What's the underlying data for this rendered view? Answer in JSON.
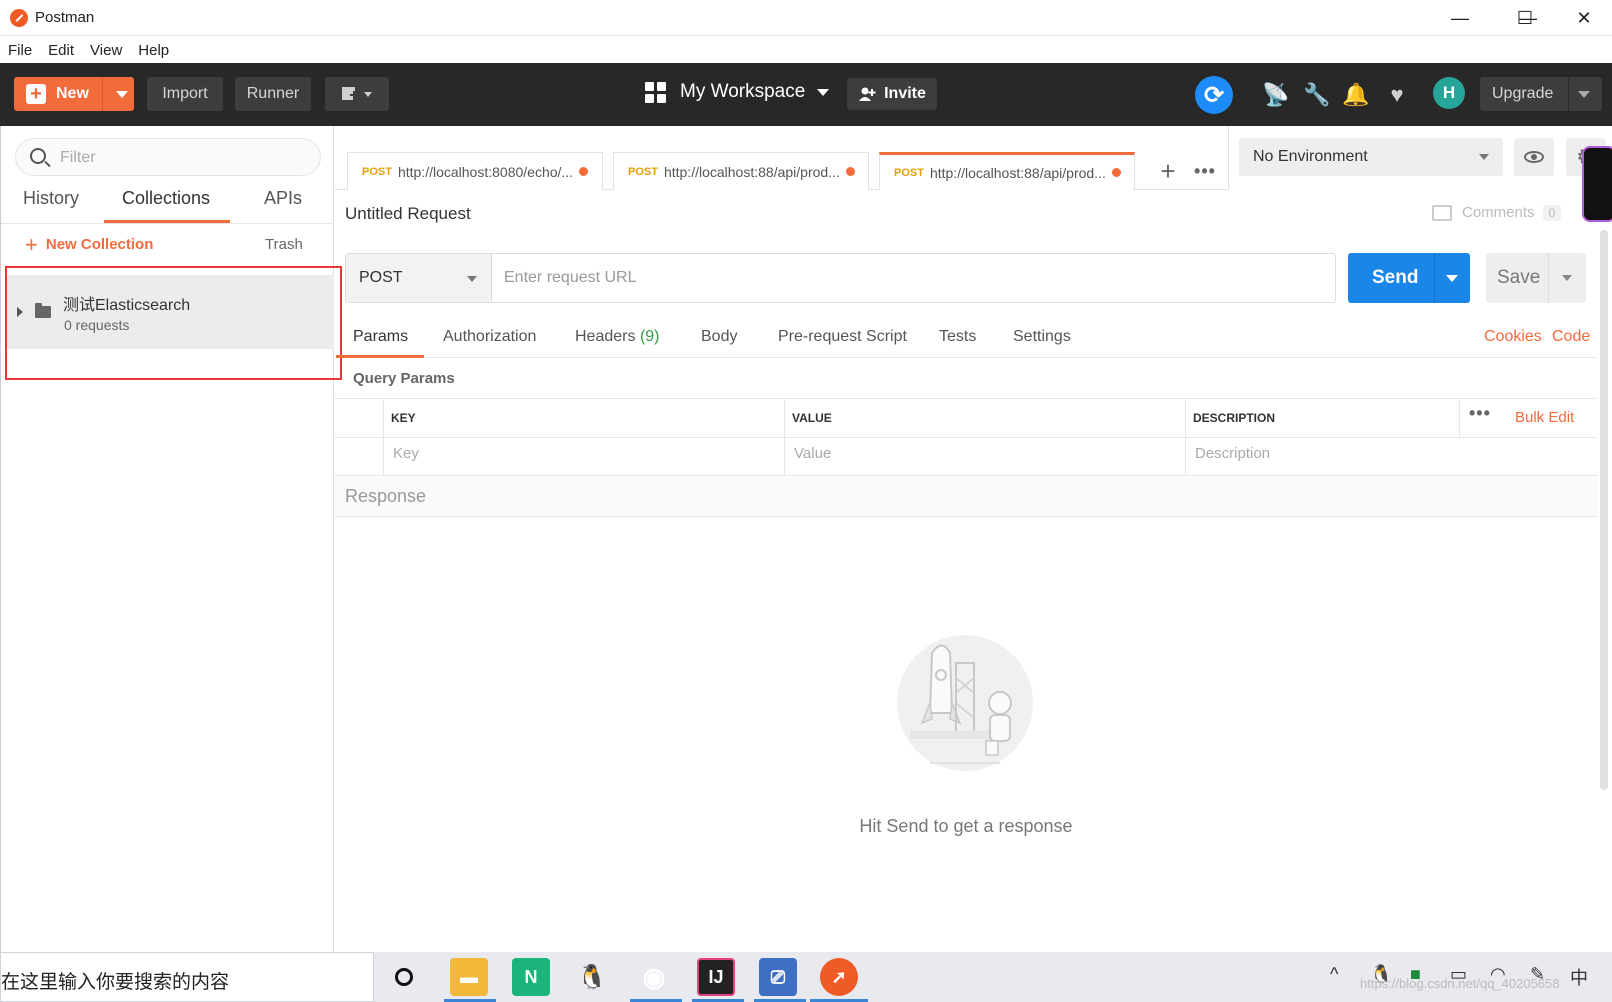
{
  "window": {
    "title": "Postman",
    "minimize": "—",
    "maximize": "☐",
    "close": "✕"
  },
  "menu": [
    "File",
    "Edit",
    "View",
    "Help"
  ],
  "header": {
    "new_label": "New",
    "import_label": "Import",
    "runner_label": "Runner",
    "workspace_label": "My Workspace",
    "invite_label": "Invite",
    "avatar_initial": "H",
    "upgrade_label": "Upgrade",
    "accent": "#f26b3a",
    "sync_color": "#1d8cf8"
  },
  "sidebar": {
    "filter_placeholder": "Filter",
    "tabs": [
      "History",
      "Collections",
      "APIs"
    ],
    "active_tab": "Collections",
    "new_collection": "New Collection",
    "trash": "Trash",
    "collections": [
      {
        "name": "测试Elasticsearch",
        "count": "0 requests"
      }
    ]
  },
  "tabs": [
    {
      "method": "POST",
      "url": "http://localhost:8080/echo/...",
      "active": false
    },
    {
      "method": "POST",
      "url": "http://localhost:88/api/prod...",
      "active": false
    },
    {
      "method": "POST",
      "url": "http://localhost:88/api/prod...",
      "active": true
    }
  ],
  "environment": {
    "selected": "No Environment"
  },
  "request": {
    "title": "Untitled Request",
    "comments_label": "Comments",
    "comments_count": "0",
    "method": "POST",
    "url_placeholder": "Enter request URL",
    "send_label": "Send",
    "save_label": "Save"
  },
  "subtabs": {
    "params": "Params",
    "authorization": "Authorization",
    "headers": "Headers",
    "headers_count": "(9)",
    "body": "Body",
    "prerequest": "Pre-request Script",
    "tests": "Tests",
    "settings": "Settings",
    "cookies": "Cookies",
    "code": "Code"
  },
  "query_params": {
    "title": "Query Params",
    "columns": [
      "KEY",
      "VALUE",
      "DESCRIPTION"
    ],
    "placeholders": [
      "Key",
      "Value",
      "Description"
    ],
    "bulk_edit": "Bulk Edit"
  },
  "response": {
    "title": "Response",
    "empty_message": "Hit Send to get a response"
  },
  "taskbar": {
    "search_text": "在这里输入你要搜索的内容",
    "watermark": "https://blog.csdn.net/qq_40205658"
  }
}
